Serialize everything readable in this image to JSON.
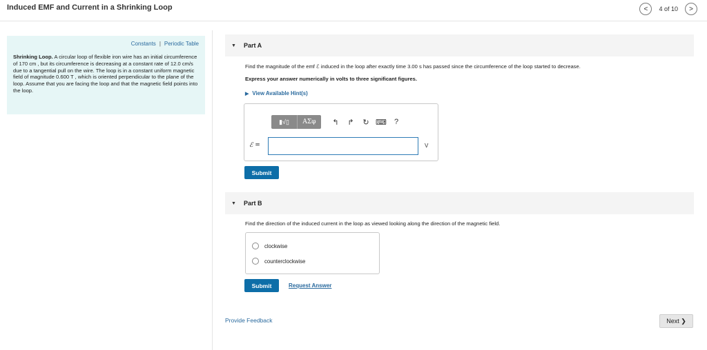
{
  "header": {
    "title": "Induced EMF and Current in a Shrinking Loop",
    "prev_glyph": "<",
    "next_glyph": ">",
    "page_count": "4 of 10"
  },
  "sidebar": {
    "constants_link": "Constants",
    "separator": "|",
    "periodic_link": "Periodic Table",
    "problem_title": "Shrinking Loop.",
    "problem_body": "A circular loop of flexible iron wire has an initial circumference of 170 cm , but its circumference is decreasing at a constant rate of 12.0 cm/s due to a tangential pull on the wire. The loop is in a constant uniform magnetic field of magnitude 0.600 T , which is oriented perpendicular to the plane of the loop. Assume that you are facing the loop and that the magnetic field points into the loop."
  },
  "partA": {
    "label": "Part A",
    "question": "Find the magnitude of the emf ℰ induced in the loop after exactly time 3.00 s has passed since the circumference of the loop started to decrease.",
    "instruction": "Express your answer numerically in volts to three significant figures.",
    "hints_link": "View Available Hint(s)",
    "toolbar": {
      "templates": "▮√▯",
      "greek": "AΣφ",
      "undo": "↰",
      "redo": "↱",
      "reset": "↻",
      "keyboard": "⌨",
      "help": "?"
    },
    "var_label": "ℰ =",
    "input_value": "",
    "unit": "V",
    "submit_label": "Submit"
  },
  "partB": {
    "label": "Part B",
    "question": "Find the direction of the induced current in the loop as viewed looking along the direction of the magnetic field.",
    "options": [
      "clockwise",
      "counterclockwise"
    ],
    "submit_label": "Submit",
    "request_label": "Request Answer"
  },
  "footer": {
    "feedback_link": "Provide Feedback",
    "next_label": "Next ❯"
  },
  "colors": {
    "accent": "#0d6ea8",
    "link": "#2a6a9e",
    "sidebar_bg": "#e6f6f6"
  }
}
